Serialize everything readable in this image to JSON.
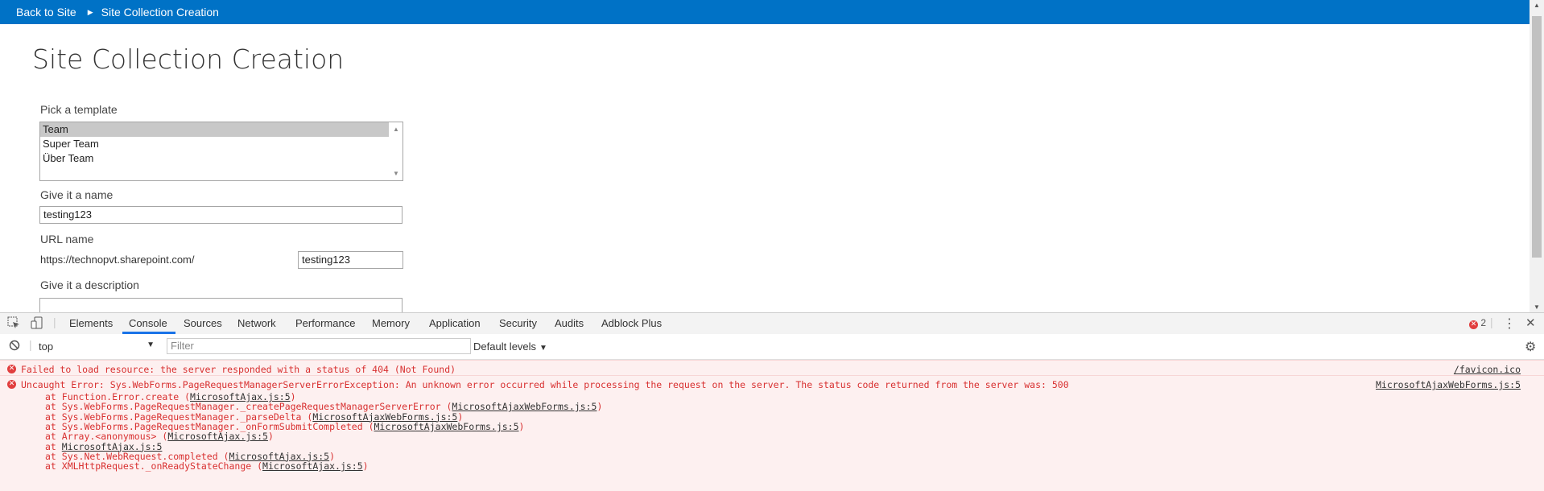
{
  "topbar": {
    "back_label": "Back to Site",
    "current_label": "Site Collection Creation"
  },
  "page": {
    "title": "Site Collection Creation",
    "template_label": "Pick a template",
    "templates": [
      "Team",
      "Super Team",
      "Über Team"
    ],
    "selected_template": "Team",
    "name_label": "Give it a name",
    "name_value": "testing123",
    "url_label": "URL name",
    "url_prefix": "https://technopvt.sharepoint.com/",
    "url_value": "testing123",
    "description_label": "Give it a description",
    "description_value": ""
  },
  "devtools": {
    "tabs": [
      "Elements",
      "Console",
      "Sources",
      "Network",
      "Performance",
      "Memory",
      "Application",
      "Security",
      "Audits",
      "Adblock Plus"
    ],
    "active_tab": "Console",
    "error_count": "2",
    "context": "top",
    "filter_placeholder": "Filter",
    "levels": "Default levels"
  },
  "console": {
    "messages": [
      {
        "level": "error",
        "text": "Failed to load resource: the server responded with a status of 404 (Not Found)",
        "source": "/favicon.ico"
      },
      {
        "level": "error",
        "text": "Uncaught Error: Sys.WebForms.PageRequestManagerServerErrorException: An unknown error occurred while processing the request on the server. The status code returned from the server was: 500",
        "source": "MicrosoftAjaxWebForms.js:5",
        "stack": [
          {
            "prefix": "at Function.Error.create (",
            "link": "MicrosoftAjax.js:5",
            "suffix": ")"
          },
          {
            "prefix": "at Sys.WebForms.PageRequestManager._createPageRequestManagerServerError (",
            "link": "MicrosoftAjaxWebForms.js:5",
            "suffix": ")"
          },
          {
            "prefix": "at Sys.WebForms.PageRequestManager._parseDelta (",
            "link": "MicrosoftAjaxWebForms.js:5",
            "suffix": ")"
          },
          {
            "prefix": "at Sys.WebForms.PageRequestManager._onFormSubmitCompleted (",
            "link": "MicrosoftAjaxWebForms.js:5",
            "suffix": ")"
          },
          {
            "prefix": "at Array.<anonymous> (",
            "link": "MicrosoftAjax.js:5",
            "suffix": ")"
          },
          {
            "prefix": "at ",
            "link": "MicrosoftAjax.js:5",
            "suffix": ""
          },
          {
            "prefix": "at Sys.Net.WebRequest.completed (",
            "link": "MicrosoftAjax.js:5",
            "suffix": ")"
          },
          {
            "prefix": "at XMLHttpRequest._onReadyStateChange (",
            "link": "MicrosoftAjax.js:5",
            "suffix": ")"
          }
        ]
      }
    ]
  },
  "colors": {
    "suite_bar": "#0072c6",
    "error_text": "#d83030",
    "error_bg": "#fdf0f0",
    "active_tab_underline": "#1a73e8"
  },
  "icons": {
    "inspect": "inspect-element-icon",
    "device": "device-toggle-icon",
    "clear": "clear-console-icon",
    "settings": "gear-icon",
    "more": "kebab-menu-icon",
    "close": "close-icon",
    "error": "error-icon"
  }
}
